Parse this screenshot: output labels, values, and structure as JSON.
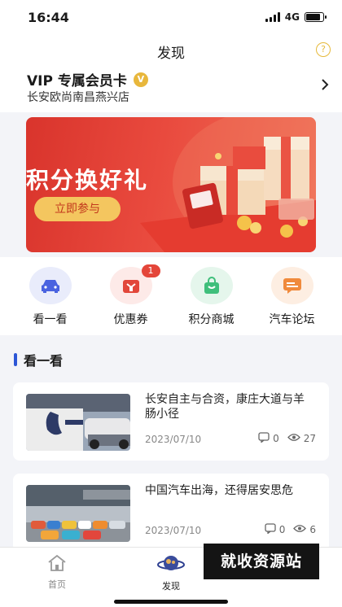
{
  "status": {
    "time": "16:44",
    "network": "4G",
    "battery_level": 0.85
  },
  "header": {
    "title": "发现",
    "help_glyph": "?"
  },
  "vip": {
    "title": "VIP 专属会员卡",
    "badge": "V",
    "store": "长安欧尚南昌燕兴店"
  },
  "banner": {
    "title": "积分换好礼",
    "button": "立即参与"
  },
  "shortcuts": [
    {
      "label": "看一看",
      "icon": "car-icon",
      "color": "#4a63e0",
      "bg": "#e9ecfb"
    },
    {
      "label": "优惠券",
      "icon": "gift-coupon-icon",
      "color": "#e2473a",
      "bg": "#fdeae8",
      "badge": "1"
    },
    {
      "label": "积分商城",
      "icon": "shopping-bag-icon",
      "color": "#3fbf7b",
      "bg": "#e5f6ec"
    },
    {
      "label": "汽车论坛",
      "icon": "chat-bubble-icon",
      "color": "#f08a3c",
      "bg": "#fdeee2"
    }
  ],
  "section": {
    "title": "看一看"
  },
  "articles": [
    {
      "title": "长安自主与合资，康庄大道与羊肠小径",
      "date": "2023/07/10",
      "comments": "0",
      "views": "27"
    },
    {
      "title": "中国汽车出海，还得居安思危",
      "date": "2023/07/10",
      "comments": "0",
      "views": "6"
    }
  ],
  "tabbar": {
    "home": "首页",
    "discover": "发现"
  },
  "watermark": "就收资源站"
}
